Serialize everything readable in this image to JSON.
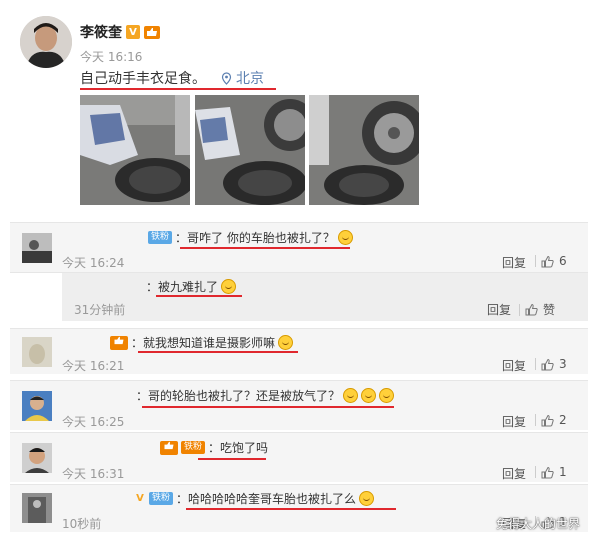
{
  "post": {
    "author": "李筱奎",
    "verified_mark": "V",
    "time": "今天 16:16",
    "text": "自己动手丰衣足食。",
    "location": "北京"
  },
  "comments": [
    {
      "tag": "铁粉",
      "text": "：哥咋了 你的车胎也被扎了？",
      "time": "今天 16:24",
      "reply": "回复",
      "likes": "6"
    },
    {
      "tag": "",
      "text": "：被九难扎了",
      "time": "31分钟前",
      "reply": "回复",
      "likes": "赞"
    },
    {
      "tag": "",
      "text": "：就我想知道谁是摄影师嘛",
      "time": "今天 16:21",
      "reply": "回复",
      "likes": "3"
    },
    {
      "tag": "",
      "text": "：哥的轮胎也被扎了？还是被放气了？",
      "time": "今天 16:25",
      "reply": "回复",
      "likes": "2"
    },
    {
      "tag": "铁粉",
      "text": "：吃饱了吗",
      "time": "今天 16:31",
      "reply": "回复",
      "likes": "1"
    },
    {
      "tag": "铁粉",
      "verified_mark": "V",
      "text": "：哈哈哈哈哈奎哥车胎也被扎了么",
      "time": "10秒前",
      "reply": "回复",
      "likes": "1"
    }
  ],
  "watermark": "免得大人的世界",
  "colors": {
    "underline": "#e0282e",
    "link": "#5b7fb0",
    "badge_blue": "#5aa8e6",
    "badge_orange": "#f08300",
    "verified": "#f5a623"
  }
}
